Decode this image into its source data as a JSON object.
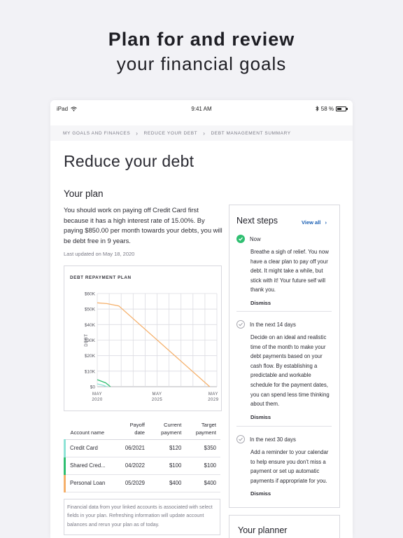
{
  "hero": {
    "line1": "Plan for and review",
    "line2": "your financial goals"
  },
  "status_bar": {
    "device": "iPad",
    "time": "9:41 AM",
    "battery": "58 %",
    "battery_level": 0.58
  },
  "breadcrumbs": [
    "MY GOALS AND FINANCES",
    "REDUCE YOUR DEBT",
    "DEBT MANAGEMENT SUMMARY"
  ],
  "page_title": "Reduce your debt",
  "plan": {
    "heading": "Your plan",
    "description": "You should work on paying off Credit Card first because it has a high interest rate of 15.00%. By paying $850.00 per month towards your debts, you will be debt free in 9 years.",
    "updated": "Last updated on May 18, 2020"
  },
  "chart_data": {
    "type": "line",
    "title": "DEBT REPAYMENT PLAN",
    "ylabel": "DEBT",
    "xlabel": "",
    "y_ticks": [
      "$60K",
      "$50K",
      "$40K",
      "$30K",
      "$20K",
      "$10K",
      "$0"
    ],
    "x_ticks": [
      {
        "line1": "MAY",
        "line2": "2020"
      },
      {
        "line1": "MAY",
        "line2": "2025"
      },
      {
        "line1": "MAY",
        "line2": "2029"
      }
    ],
    "ylim": [
      0,
      60000
    ],
    "xlim": [
      2020.0,
      2030.0
    ],
    "grid": true,
    "series": [
      {
        "color": "#f5b06b",
        "x": [
          2020.0,
          2020.8,
          2021.8,
          2029.4
        ],
        "y": [
          54000,
          53500,
          52000,
          0
        ]
      },
      {
        "color": "#2fbf71",
        "x": [
          2020.0,
          2020.7,
          2021.1
        ],
        "y": [
          4500,
          2500,
          0
        ]
      },
      {
        "color": "#8ee3d6",
        "x": [
          2020.0,
          2020.5,
          2020.8
        ],
        "y": [
          1800,
          900,
          0
        ]
      }
    ]
  },
  "table": {
    "headers": {
      "name": "Account name",
      "payoff": "Payoff date",
      "current": "Current payment",
      "target": "Target payment"
    },
    "rows": [
      {
        "name": "Credit Card",
        "payoff": "06/2021",
        "current": "$120",
        "target": "$350",
        "color": "#8ee3d6"
      },
      {
        "name": "Shared Cred...",
        "payoff": "04/2022",
        "current": "$100",
        "target": "$100",
        "color": "#2fbf71"
      },
      {
        "name": "Personal Loan",
        "payoff": "05/2029",
        "current": "$400",
        "target": "$400",
        "color": "#f5b06b"
      }
    ]
  },
  "note": "Financial data from your linked accounts is associated with select fields in your plan. Refreshing information will update account balances and rerun your plan as of today.",
  "next_steps": {
    "heading": "Next steps",
    "view_all": "View all",
    "steps": [
      {
        "title": "Now",
        "done": true,
        "body": "Breathe a sigh of relief. You now have a clear plan to pay off your debt. It might take a while, but stick with it! Your future self will thank you.",
        "action": "Dismiss"
      },
      {
        "title": "In the next 14 days",
        "done": false,
        "body": "Decide on an ideal and realistic time of the month to make your debt payments based on your cash flow. By establishing a predictable and workable schedule for the payment dates, you can spend less time thinking about them.",
        "action": "Dismiss"
      },
      {
        "title": "In the next 30 days",
        "done": false,
        "body": "Add a reminder to your calendar to help ensure you don't miss a payment or set up automatic payments if appropriate for you.",
        "action": "Dismiss"
      }
    ]
  },
  "planner": {
    "heading": "Your planner"
  }
}
